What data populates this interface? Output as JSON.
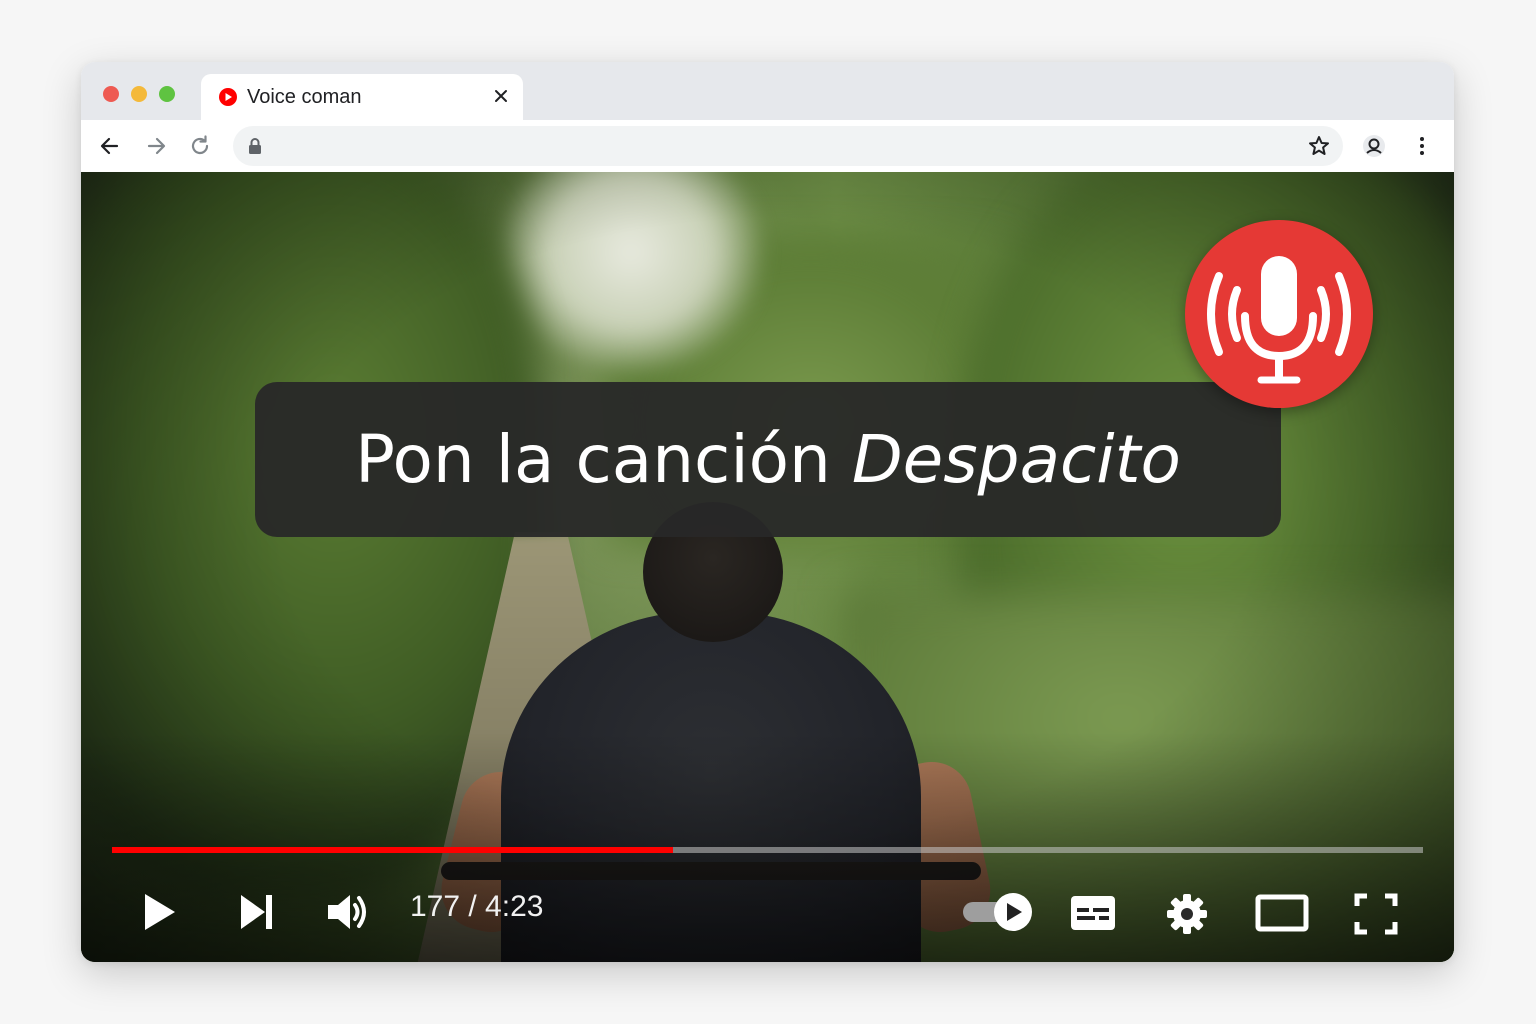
{
  "browser": {
    "tab": {
      "title": "Voice coman",
      "favicon": "youtube-icon"
    },
    "address": {
      "url": ""
    }
  },
  "overlay": {
    "caption_prefix": "Pon la canción ",
    "caption_song": "Despacito",
    "mic_icon": "microphone-listening-icon",
    "mic_color": "#e53935"
  },
  "player": {
    "progress_fraction": 0.428,
    "time_display": "177 / 4:23",
    "progress_color": "#ff0000",
    "controls": [
      "play-icon",
      "next-icon",
      "volume-icon",
      "autoplay-toggle",
      "subtitles-icon",
      "settings-icon",
      "theater-mode-icon",
      "fullscreen-icon"
    ]
  }
}
